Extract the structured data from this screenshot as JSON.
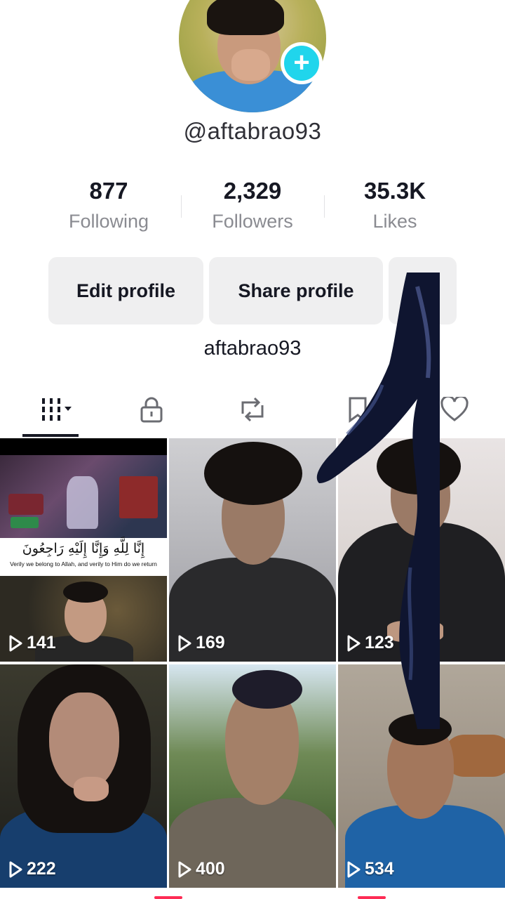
{
  "profile": {
    "username": "@aftabrao93",
    "display_name": "aftabrao93"
  },
  "stats": {
    "following": {
      "value": "877",
      "label": "Following"
    },
    "followers": {
      "value": "2,329",
      "label": "Followers"
    },
    "likes": {
      "value": "35.3K",
      "label": "Likes"
    }
  },
  "buttons": {
    "edit_profile": "Edit profile",
    "share_profile": "Share profile"
  },
  "tabs": [
    {
      "icon": "videos-grid-icon",
      "active": true
    },
    {
      "icon": "lock-icon",
      "active": false
    },
    {
      "icon": "repost-icon",
      "active": false
    },
    {
      "icon": "bookmark-icon",
      "active": false
    },
    {
      "icon": "heart-icon",
      "active": false
    }
  ],
  "videos": [
    {
      "views": "141",
      "caption_ar": "إِنَّا لِلَّهِ وَإِنَّا إِلَيْهِ رَاجِعُونَ",
      "caption_en": "Verily we belong to Allah, and verily to Him do we return"
    },
    {
      "views": "169"
    },
    {
      "views": "123"
    },
    {
      "views": "222"
    },
    {
      "views": "400"
    },
    {
      "views": "534"
    }
  ],
  "colors": {
    "accent": "#20d5ec",
    "brand": "#fe2c55",
    "text": "#161823",
    "muted": "#8a8b91",
    "button_bg": "#efeff0"
  }
}
